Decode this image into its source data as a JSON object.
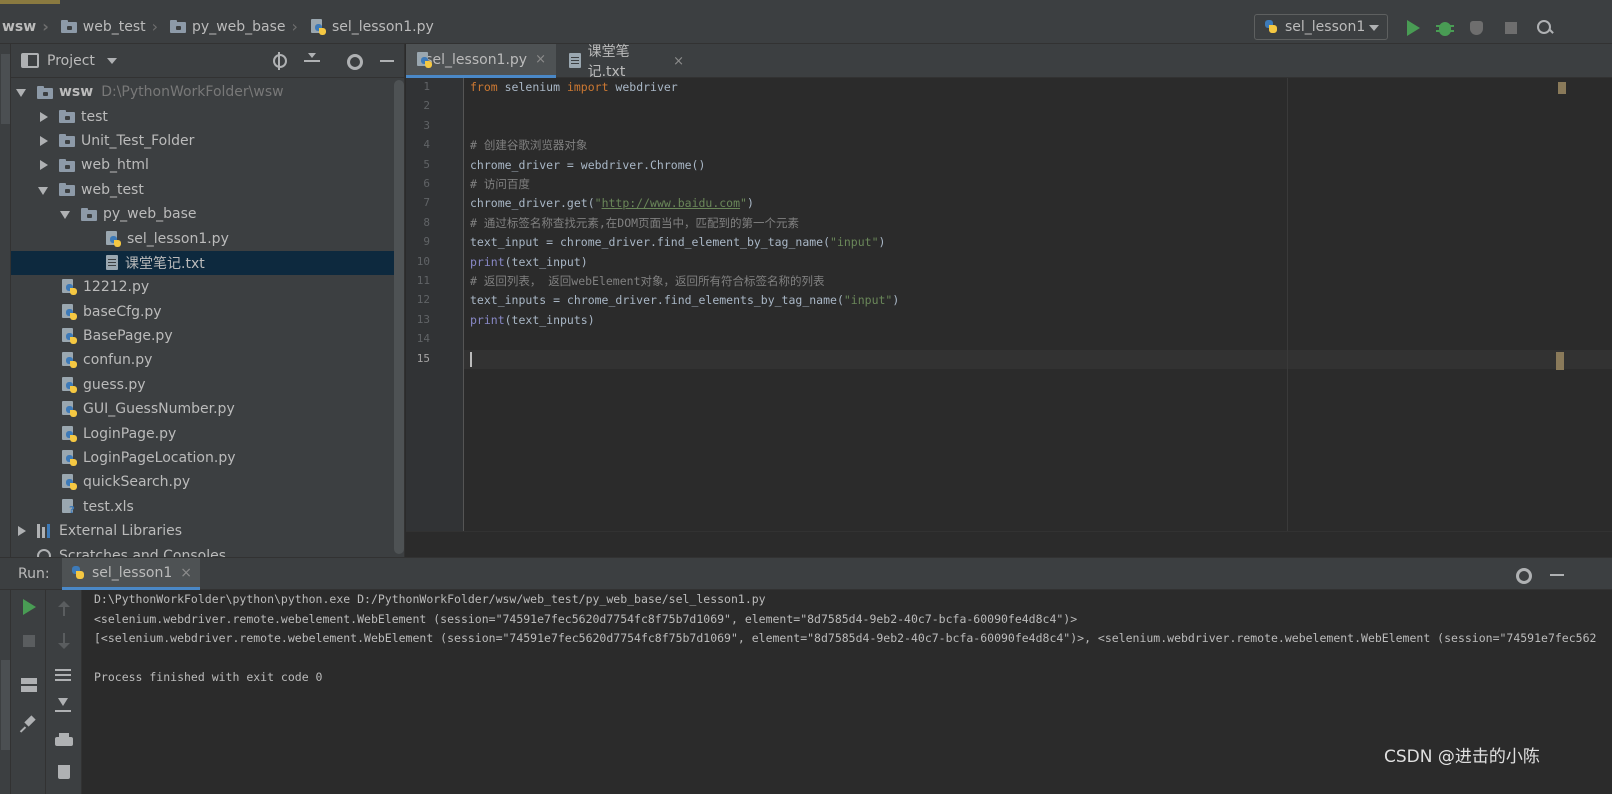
{
  "colors": {
    "background": "#2b2b2b",
    "panel": "#3c3f41",
    "selection": "#0d293e",
    "accent": "#4a88c7",
    "run_green": "#499c54",
    "keyword": "#cc7832",
    "comment": "#808080",
    "string": "#6a8759",
    "code_text": "#a9b7c6"
  },
  "breadcrumb": [
    "wsw",
    "web_test",
    "py_web_base",
    "sel_lesson1.py"
  ],
  "toolbar": {
    "run_config": "sel_lesson1",
    "icons": [
      "run-icon",
      "debug-icon",
      "coverage-icon",
      "stop-icon",
      "search-icon"
    ]
  },
  "project": {
    "title": "Project",
    "root_name": "wsw",
    "root_path": "D:\\PythonWorkFolder\\wsw",
    "items": [
      {
        "label": "test",
        "type": "folder"
      },
      {
        "label": "Unit_Test_Folder",
        "type": "folder"
      },
      {
        "label": "web_html",
        "type": "folder"
      },
      {
        "label": "web_test",
        "type": "folder"
      },
      {
        "label": "py_web_base",
        "type": "folder"
      },
      {
        "label": "sel_lesson1.py",
        "type": "python"
      },
      {
        "label": "课堂笔记.txt",
        "type": "text",
        "selected": true
      },
      {
        "label": "12212.py",
        "type": "python"
      },
      {
        "label": "baseCfg.py",
        "type": "python"
      },
      {
        "label": "BasePage.py",
        "type": "python"
      },
      {
        "label": "confun.py",
        "type": "python"
      },
      {
        "label": "guess.py",
        "type": "python"
      },
      {
        "label": "GUI_GuessNumber.py",
        "type": "python"
      },
      {
        "label": "LoginPage.py",
        "type": "python"
      },
      {
        "label": "LoginPageLocation.py",
        "type": "python"
      },
      {
        "label": "quickSearch.py",
        "type": "python"
      },
      {
        "label": "test.xls",
        "type": "excel"
      },
      {
        "label": "External Libraries",
        "type": "library"
      },
      {
        "label": "Scratches and Consoles",
        "type": "scratch"
      }
    ]
  },
  "editor": {
    "tabs": [
      {
        "label": "sel_lesson1.py",
        "close": "×"
      },
      {
        "label": "课堂笔记.txt",
        "close": "×"
      }
    ],
    "line_numbers": [
      "1",
      "2",
      "3",
      "4",
      "5",
      "6",
      "7",
      "8",
      "9",
      "10",
      "11",
      "12",
      "13",
      "14",
      "15"
    ],
    "code": {
      "l1_from": "from",
      "l1_mod": " selenium ",
      "l1_import": "import",
      "l1_name": " webdriver",
      "l4": "# 创建谷歌浏览器对象",
      "l5": "chrome_driver = webdriver.Chrome()",
      "l6": "# 访问百度",
      "l7_pre": "chrome_driver.get(",
      "l7_q1": "\"",
      "l7_url": "http://www.baidu.com",
      "l7_q2": "\"",
      "l7_post": ")",
      "l8": "# 通过标签名称查找元素,在DOM页面当中，匹配到的第一个元素",
      "l9_pre": "text_input = chrome_driver.find_element_by_tag_name(",
      "l9_str": "\"input\"",
      "l9_post": ")",
      "l10_fn": "print",
      "l10_rest": "(text_input)",
      "l11": "# 返回列表， 返回webElement对象，返回所有符合标签名称的列表",
      "l12_pre": "text_inputs = chrome_driver.find_elements_by_tag_name(",
      "l12_str": "\"input\"",
      "l12_post": ")",
      "l13_fn": "print",
      "l13_rest": "(text_inputs)"
    }
  },
  "run": {
    "label": "Run:",
    "tab": "sel_lesson1",
    "tab_close": "×",
    "console": [
      "D:\\PythonWorkFolder\\python\\python.exe D:/PythonWorkFolder/wsw/web_test/py_web_base/sel_lesson1.py",
      "<selenium.webdriver.remote.webelement.WebElement (session=\"74591e7fec5620d7754fc8f75b7d1069\", element=\"8d7585d4-9eb2-40c7-bcfa-60090fe4d8c4\")>",
      "[<selenium.webdriver.remote.webelement.WebElement (session=\"74591e7fec5620d7754fc8f75b7d1069\", element=\"8d7585d4-9eb2-40c7-bcfa-60090fe4d8c4\")>, <selenium.webdriver.remote.webelement.WebElement (session=\"74591e7fec562",
      "",
      "Process finished with exit code 0"
    ]
  },
  "watermark": "CSDN @进击的小陈"
}
